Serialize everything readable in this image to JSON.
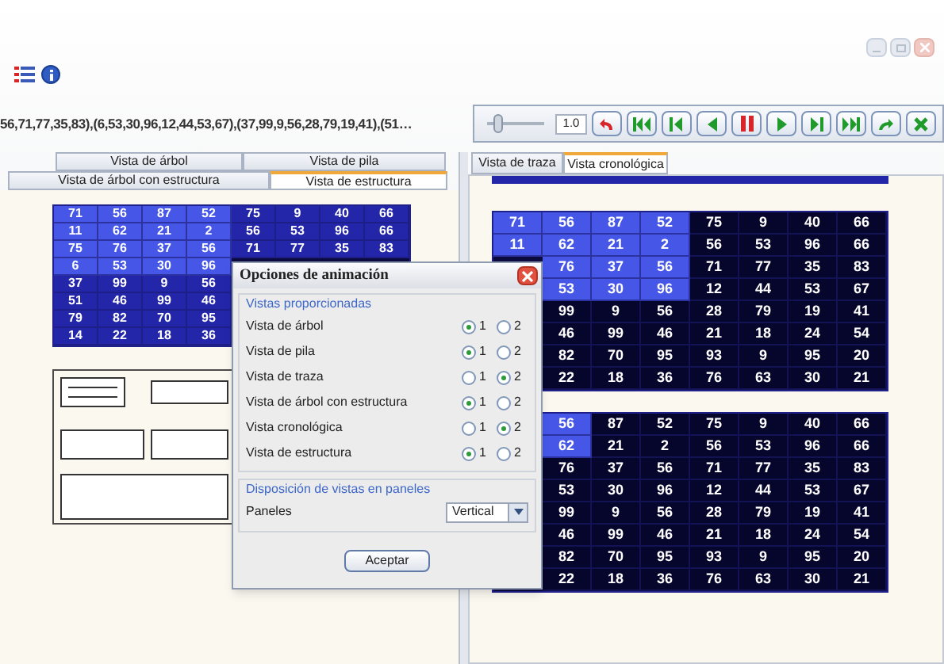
{
  "array_field": {
    "value": "56,71,77,35,83),(6,53,30,96,12,44,53,67),(37,99,9,56,28,79,19,41),(51…"
  },
  "animation_bar": {
    "speed_slider": {
      "level": 0.2
    },
    "speed": "1.0",
    "buttons": [
      {
        "kind": "undo"
      },
      {
        "kind": "first"
      },
      {
        "kind": "step-back"
      },
      {
        "kind": "back"
      },
      {
        "kind": "pause"
      },
      {
        "kind": "play"
      },
      {
        "kind": "step-forward"
      },
      {
        "kind": "last"
      },
      {
        "kind": "redo"
      },
      {
        "kind": "close"
      }
    ]
  },
  "left_panel": {
    "tab_rows": [
      [
        {
          "label": "Vista de árbol",
          "selected": false
        },
        {
          "label": "Vista de pila",
          "selected": false
        }
      ],
      [
        {
          "label": "Vista de árbol con estructura",
          "selected": false
        },
        {
          "label": "Vista de estructura",
          "selected": true
        }
      ]
    ],
    "matrix": {
      "rows": [
        [
          {
            "value": "71",
            "kind": "bright"
          },
          {
            "value": "56",
            "kind": "bright"
          },
          {
            "value": "87",
            "kind": "bright"
          },
          {
            "value": "52",
            "kind": "bright"
          },
          {
            "value": "75",
            "kind": "blue"
          },
          {
            "value": "9",
            "kind": "blue"
          },
          {
            "value": "40",
            "kind": "blue"
          },
          {
            "value": "66",
            "kind": "blue"
          }
        ],
        [
          {
            "value": "11",
            "kind": "bright"
          },
          {
            "value": "62",
            "kind": "bright"
          },
          {
            "value": "21",
            "kind": "bright"
          },
          {
            "value": "2",
            "kind": "bright"
          },
          {
            "value": "56",
            "kind": "blue"
          },
          {
            "value": "53",
            "kind": "blue"
          },
          {
            "value": "96",
            "kind": "blue"
          },
          {
            "value": "66",
            "kind": "blue"
          }
        ],
        [
          {
            "value": "75",
            "kind": "bright"
          },
          {
            "value": "76",
            "kind": "bright"
          },
          {
            "value": "37",
            "kind": "bright"
          },
          {
            "value": "56",
            "kind": "bright"
          },
          {
            "value": "71",
            "kind": "blue"
          },
          {
            "value": "77",
            "kind": "blue"
          },
          {
            "value": "35",
            "kind": "blue"
          },
          {
            "value": "83",
            "kind": "blue"
          }
        ],
        [
          {
            "value": "6",
            "kind": "bright"
          },
          {
            "value": "53",
            "kind": "bright"
          },
          {
            "value": "30",
            "kind": "bright"
          },
          {
            "value": "96",
            "kind": "bright"
          },
          null,
          null,
          null,
          null
        ],
        [
          {
            "value": "37",
            "kind": "blue"
          },
          {
            "value": "99",
            "kind": "blue"
          },
          {
            "value": "9",
            "kind": "blue"
          },
          {
            "value": "56",
            "kind": "blue"
          },
          null,
          null,
          null,
          null
        ],
        [
          {
            "value": "51",
            "kind": "blue"
          },
          {
            "value": "46",
            "kind": "blue"
          },
          {
            "value": "99",
            "kind": "blue"
          },
          {
            "value": "46",
            "kind": "blue"
          },
          null,
          null,
          null,
          null
        ],
        [
          {
            "value": "79",
            "kind": "blue"
          },
          {
            "value": "82",
            "kind": "blue"
          },
          {
            "value": "70",
            "kind": "blue"
          },
          {
            "value": "95",
            "kind": "blue"
          },
          null,
          null,
          null,
          null
        ],
        [
          {
            "value": "14",
            "kind": "blue"
          },
          {
            "value": "22",
            "kind": "blue"
          },
          {
            "value": "18",
            "kind": "blue"
          },
          {
            "value": "36",
            "kind": "blue"
          },
          null,
          null,
          null,
          null
        ]
      ]
    }
  },
  "right_panel": {
    "tabs": [
      {
        "label": "Vista de traza",
        "selected": false
      },
      {
        "label": "Vista cronológica",
        "selected": true
      }
    ],
    "matrices": [
      {
        "rows": [
          [
            {
              "value": "71",
              "kind": "bright"
            },
            {
              "value": "56",
              "kind": "bright"
            },
            {
              "value": "87",
              "kind": "bright"
            },
            {
              "value": "52",
              "kind": "bright"
            },
            {
              "value": "75",
              "kind": "dark"
            },
            {
              "value": "9",
              "kind": "dark"
            },
            {
              "value": "40",
              "kind": "dark"
            },
            {
              "value": "66",
              "kind": "dark"
            }
          ],
          [
            {
              "value": "11",
              "kind": "bright"
            },
            {
              "value": "62",
              "kind": "bright"
            },
            {
              "value": "21",
              "kind": "bright"
            },
            {
              "value": "2",
              "kind": "bright"
            },
            {
              "value": "56",
              "kind": "dark"
            },
            {
              "value": "53",
              "kind": "dark"
            },
            {
              "value": "96",
              "kind": "dark"
            },
            {
              "value": "66",
              "kind": "dark"
            }
          ],
          [
            null,
            {
              "value": "76",
              "kind": "bright"
            },
            {
              "value": "37",
              "kind": "bright"
            },
            {
              "value": "56",
              "kind": "bright"
            },
            {
              "value": "71",
              "kind": "dark"
            },
            {
              "value": "77",
              "kind": "dark"
            },
            {
              "value": "35",
              "kind": "dark"
            },
            {
              "value": "83",
              "kind": "dark"
            }
          ],
          [
            null,
            {
              "value": "53",
              "kind": "bright"
            },
            {
              "value": "30",
              "kind": "bright"
            },
            {
              "value": "96",
              "kind": "bright"
            },
            {
              "value": "12",
              "kind": "dark"
            },
            {
              "value": "44",
              "kind": "dark"
            },
            {
              "value": "53",
              "kind": "dark"
            },
            {
              "value": "67",
              "kind": "dark"
            }
          ],
          [
            null,
            {
              "value": "99",
              "kind": "dark"
            },
            {
              "value": "9",
              "kind": "dark"
            },
            {
              "value": "56",
              "kind": "dark"
            },
            {
              "value": "28",
              "kind": "dark"
            },
            {
              "value": "79",
              "kind": "dark"
            },
            {
              "value": "19",
              "kind": "dark"
            },
            {
              "value": "41",
              "kind": "dark"
            }
          ],
          [
            null,
            {
              "value": "46",
              "kind": "dark"
            },
            {
              "value": "99",
              "kind": "dark"
            },
            {
              "value": "46",
              "kind": "dark"
            },
            {
              "value": "21",
              "kind": "dark"
            },
            {
              "value": "18",
              "kind": "dark"
            },
            {
              "value": "24",
              "kind": "dark"
            },
            {
              "value": "54",
              "kind": "dark"
            }
          ],
          [
            null,
            {
              "value": "82",
              "kind": "dark"
            },
            {
              "value": "70",
              "kind": "dark"
            },
            {
              "value": "95",
              "kind": "dark"
            },
            {
              "value": "93",
              "kind": "dark"
            },
            {
              "value": "9",
              "kind": "dark"
            },
            {
              "value": "95",
              "kind": "dark"
            },
            {
              "value": "20",
              "kind": "dark"
            }
          ],
          [
            null,
            {
              "value": "22",
              "kind": "dark"
            },
            {
              "value": "18",
              "kind": "dark"
            },
            {
              "value": "36",
              "kind": "dark"
            },
            {
              "value": "76",
              "kind": "dark"
            },
            {
              "value": "63",
              "kind": "dark"
            },
            {
              "value": "30",
              "kind": "dark"
            },
            {
              "value": "21",
              "kind": "dark"
            }
          ]
        ]
      },
      {
        "rows": [
          [
            null,
            {
              "value": "56",
              "kind": "bright"
            },
            {
              "value": "87",
              "kind": "dark"
            },
            {
              "value": "52",
              "kind": "dark"
            },
            {
              "value": "75",
              "kind": "dark"
            },
            {
              "value": "9",
              "kind": "dark"
            },
            {
              "value": "40",
              "kind": "dark"
            },
            {
              "value": "66",
              "kind": "dark"
            }
          ],
          [
            null,
            {
              "value": "62",
              "kind": "bright"
            },
            {
              "value": "21",
              "kind": "dark"
            },
            {
              "value": "2",
              "kind": "dark"
            },
            {
              "value": "56",
              "kind": "dark"
            },
            {
              "value": "53",
              "kind": "dark"
            },
            {
              "value": "96",
              "kind": "dark"
            },
            {
              "value": "66",
              "kind": "dark"
            }
          ],
          [
            null,
            {
              "value": "76",
              "kind": "dark"
            },
            {
              "value": "37",
              "kind": "dark"
            },
            {
              "value": "56",
              "kind": "dark"
            },
            {
              "value": "71",
              "kind": "dark"
            },
            {
              "value": "77",
              "kind": "dark"
            },
            {
              "value": "35",
              "kind": "dark"
            },
            {
              "value": "83",
              "kind": "dark"
            }
          ],
          [
            null,
            {
              "value": "53",
              "kind": "dark"
            },
            {
              "value": "30",
              "kind": "dark"
            },
            {
              "value": "96",
              "kind": "dark"
            },
            {
              "value": "12",
              "kind": "dark"
            },
            {
              "value": "44",
              "kind": "dark"
            },
            {
              "value": "53",
              "kind": "dark"
            },
            {
              "value": "67",
              "kind": "dark"
            }
          ],
          [
            null,
            {
              "value": "99",
              "kind": "dark"
            },
            {
              "value": "9",
              "kind": "dark"
            },
            {
              "value": "56",
              "kind": "dark"
            },
            {
              "value": "28",
              "kind": "dark"
            },
            {
              "value": "79",
              "kind": "dark"
            },
            {
              "value": "19",
              "kind": "dark"
            },
            {
              "value": "41",
              "kind": "dark"
            }
          ],
          [
            null,
            {
              "value": "46",
              "kind": "dark"
            },
            {
              "value": "99",
              "kind": "dark"
            },
            {
              "value": "46",
              "kind": "dark"
            },
            {
              "value": "21",
              "kind": "dark"
            },
            {
              "value": "18",
              "kind": "dark"
            },
            {
              "value": "24",
              "kind": "dark"
            },
            {
              "value": "54",
              "kind": "dark"
            }
          ],
          [
            null,
            {
              "value": "82",
              "kind": "dark"
            },
            {
              "value": "70",
              "kind": "dark"
            },
            {
              "value": "95",
              "kind": "dark"
            },
            {
              "value": "93",
              "kind": "dark"
            },
            {
              "value": "9",
              "kind": "dark"
            },
            {
              "value": "95",
              "kind": "dark"
            },
            {
              "value": "20",
              "kind": "dark"
            }
          ],
          [
            null,
            {
              "value": "22",
              "kind": "dark"
            },
            {
              "value": "18",
              "kind": "dark"
            },
            {
              "value": "36",
              "kind": "dark"
            },
            {
              "value": "76",
              "kind": "dark"
            },
            {
              "value": "63",
              "kind": "dark"
            },
            {
              "value": "30",
              "kind": "dark"
            },
            {
              "value": "21",
              "kind": "dark"
            }
          ]
        ]
      }
    ]
  },
  "dialog": {
    "title": "Opciones de animación",
    "views_group": {
      "title": "Vistas proporcionadas",
      "rows": [
        {
          "label": "Vista de árbol",
          "options": [
            {
              "label": "1",
              "selected": true
            },
            {
              "label": "2",
              "selected": false
            }
          ]
        },
        {
          "label": "Vista de pila",
          "options": [
            {
              "label": "1",
              "selected": true
            },
            {
              "label": "2",
              "selected": false
            }
          ]
        },
        {
          "label": "Vista de traza",
          "options": [
            {
              "label": "1",
              "selected": false
            },
            {
              "label": "2",
              "selected": true
            }
          ]
        },
        {
          "label": "Vista de árbol con estructura",
          "options": [
            {
              "label": "1",
              "selected": true
            },
            {
              "label": "2",
              "selected": false
            }
          ]
        },
        {
          "label": "Vista cronológica",
          "options": [
            {
              "label": "1",
              "selected": false
            },
            {
              "label": "2",
              "selected": true
            }
          ]
        },
        {
          "label": "Vista de estructura",
          "options": [
            {
              "label": "1",
              "selected": true
            },
            {
              "label": "2",
              "selected": false
            }
          ]
        }
      ]
    },
    "layout_group": {
      "title": "Disposición de vistas en paneles",
      "label": "Paneles",
      "value": "Vertical"
    },
    "button": "Aceptar"
  }
}
